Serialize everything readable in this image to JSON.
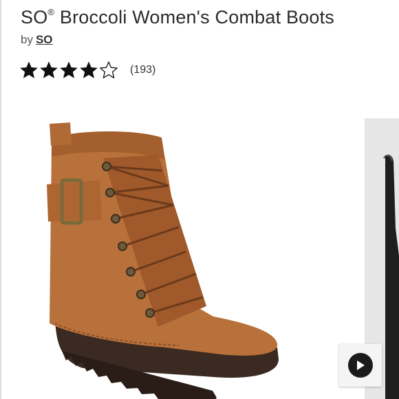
{
  "product": {
    "brand_prefix": "SO",
    "registered_mark": "®",
    "title_rest": " Broccoli Women's Combat Boots",
    "by_label": "by",
    "brand_link": "SO"
  },
  "rating": {
    "value": 4,
    "max": 5,
    "count_text": "(193)"
  },
  "gallery": {
    "main_image": "boot-photo-cognac",
    "next_image": "boot-photo-black",
    "video_button_icon": "play-icon"
  },
  "colors": {
    "boot": "#b8713a",
    "sole": "#3a2a22",
    "next_panel": "#e6e6e6"
  }
}
